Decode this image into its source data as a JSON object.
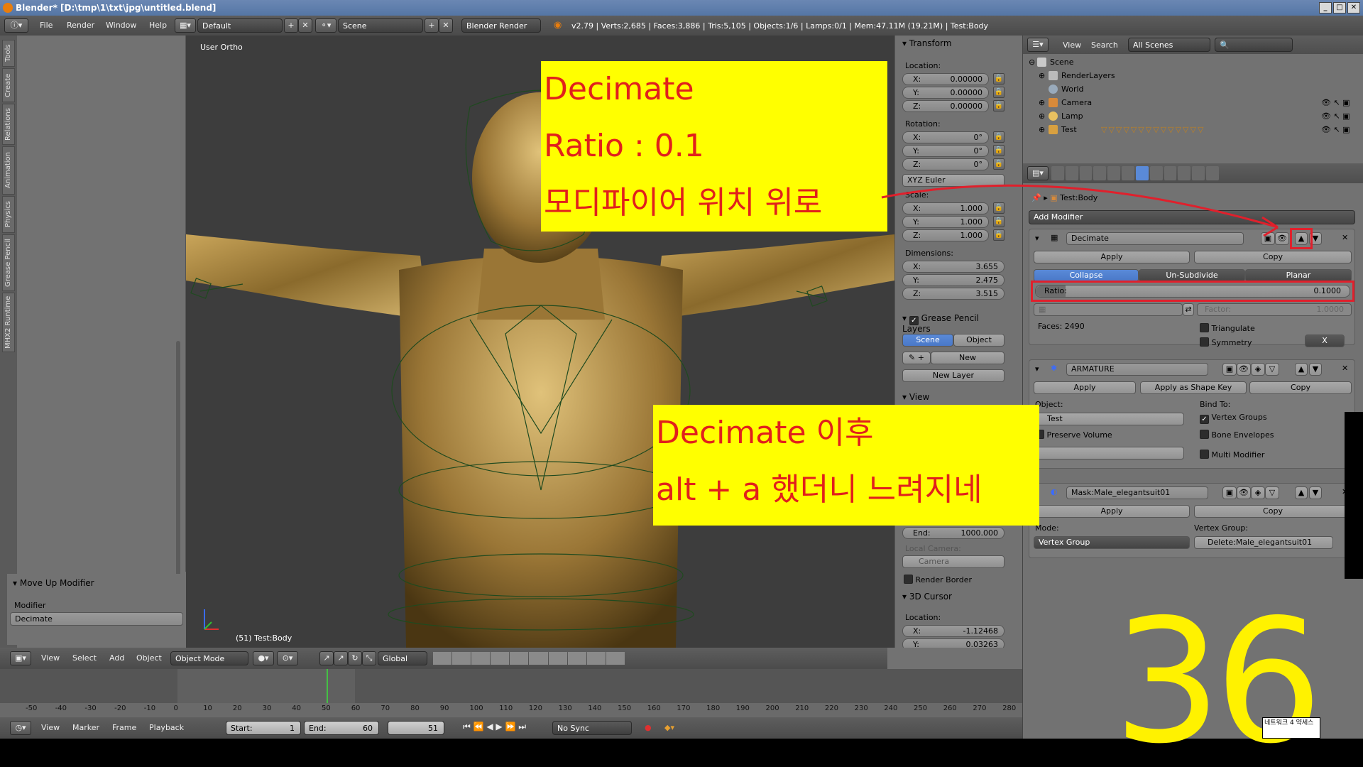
{
  "window": {
    "title": "Blender* [D:\\tmp\\1\\txt\\jpg\\untitled.blend]"
  },
  "menubar": {
    "menus": [
      "File",
      "Render",
      "Window",
      "Help"
    ],
    "layout": "Default",
    "scene": "Scene",
    "engine": "Blender Render",
    "stats": "v2.79 | Verts:2,685 | Faces:3,886 | Tris:5,105 | Objects:1/6 | Lamps:0/1 | Mem:47.11M (19.21M) | Test:Body"
  },
  "toolshelf": {
    "tabs": [
      "Tools",
      "Create",
      "Relations",
      "Animation",
      "Physics",
      "Grease Pencil",
      "MHX2 Runtime"
    ],
    "operator_title": "Move Up Modifier",
    "modifier_label": "Modifier",
    "modifier_value": "Decimate"
  },
  "viewport": {
    "label": "User Ortho",
    "object_label": "(51) Test:Body"
  },
  "npanel": {
    "transform_title": "Transform",
    "location_label": "Location:",
    "location": [
      {
        "k": "X:",
        "v": "0.00000"
      },
      {
        "k": "Y:",
        "v": "0.00000"
      },
      {
        "k": "Z:",
        "v": "0.00000"
      }
    ],
    "rotation_label": "Rotation:",
    "rotation": [
      {
        "k": "X:",
        "v": "0°"
      },
      {
        "k": "Y:",
        "v": "0°"
      },
      {
        "k": "Z:",
        "v": "0°"
      }
    ],
    "rotation_mode": "XYZ Euler",
    "scale_label": "Scale:",
    "scale": [
      {
        "k": "X:",
        "v": "1.000"
      },
      {
        "k": "Y:",
        "v": "1.000"
      },
      {
        "k": "Z:",
        "v": "1.000"
      }
    ],
    "dimensions_label": "Dimensions:",
    "dimensions": [
      {
        "k": "X:",
        "v": "3.655"
      },
      {
        "k": "Y:",
        "v": "2.475"
      },
      {
        "k": "Z:",
        "v": "3.515"
      }
    ],
    "grease_title": "Grease Pencil Layers",
    "scene_btn": "Scene",
    "object_btn": "Object",
    "new_btn": "New",
    "new_layer_btn": "New Layer",
    "view_title": "View",
    "end_label": "End:",
    "end_value": "1000.000",
    "local_camera_label": "Local Camera:",
    "camera_placeholder": "Camera",
    "render_border": "Render Border",
    "cursor_title": "3D Cursor",
    "cursor_location_label": "Location:",
    "cursor": [
      {
        "k": "X:",
        "v": "-1.12468"
      },
      {
        "k": "Y:",
        "v": "0.03263"
      }
    ]
  },
  "outliner": {
    "menu_view": "View",
    "menu_search": "Search",
    "filter": "All Scenes",
    "rows": [
      "Scene",
      "RenderLayers",
      "World",
      "Camera",
      "Lamp",
      "Test"
    ]
  },
  "properties": {
    "object_path": "Test:Body",
    "add_modifier": "Add Modifier",
    "decimate": {
      "name": "Decimate",
      "apply": "Apply",
      "copy": "Copy",
      "tabs": [
        "Collapse",
        "Un-Subdivide",
        "Planar"
      ],
      "ratio_label": "Ratio:",
      "ratio_value": "0.1000",
      "factor_label": "Factor:",
      "factor_value": "1.0000",
      "faces": "Faces: 2490",
      "triangulate": "Triangulate",
      "symmetry": "Symmetry",
      "axis": "X"
    },
    "armature": {
      "name": "ARMATURE",
      "apply": "Apply",
      "apply_shape": "Apply as Shape Key",
      "copy": "Copy",
      "object_label": "Object:",
      "object_value": "Test",
      "bind_to": "Bind To:",
      "vertex_groups": "Vertex Groups",
      "bone_envelopes": "Bone Envelopes",
      "preserve_volume": "Preserve Volume",
      "multi_modifier": "Multi Modifier"
    },
    "mask": {
      "name": "Mask:Male_elegantsuit01",
      "apply": "Apply",
      "copy": "Copy",
      "mode_label": "Mode:",
      "mode_value": "Vertex Group",
      "vgroup_label": "Vertex Group:",
      "vgroup_value": "Delete:Male_elegantsuit01"
    }
  },
  "viewport_header": {
    "menus": [
      "View",
      "Select",
      "Add",
      "Object"
    ],
    "mode": "Object Mode",
    "orientation": "Global"
  },
  "timeline": {
    "ticks": [
      "-50",
      "-40",
      "-30",
      "-20",
      "-10",
      "0",
      "10",
      "20",
      "30",
      "40",
      "50",
      "60",
      "70",
      "80",
      "90",
      "100",
      "110",
      "120",
      "130",
      "140",
      "150",
      "160",
      "170",
      "180",
      "190",
      "200",
      "210",
      "220",
      "230",
      "240",
      "250",
      "260",
      "270",
      "280"
    ],
    "current_frame": 51,
    "menus": [
      "View",
      "Marker",
      "Frame",
      "Playback"
    ],
    "start_label": "Start:",
    "start_value": "1",
    "end_label": "End:",
    "end_value": "60",
    "frame_value": "51",
    "sync": "No Sync"
  },
  "notes": {
    "note1": [
      "Decimate",
      "Ratio : 0.1",
      "모디파이어 위치 위로"
    ],
    "note2": [
      "Decimate 이후",
      "alt + a 했더니 느려지네"
    ],
    "big_number": "36",
    "watermark": "네트워크 4 약세스"
  },
  "colors": {
    "annotation_yellow": "#ffff00",
    "annotation_red": "#e1201c",
    "big_number": "#fff200",
    "blender_bg": "#727272",
    "active_blue": "#5a8ad8"
  }
}
